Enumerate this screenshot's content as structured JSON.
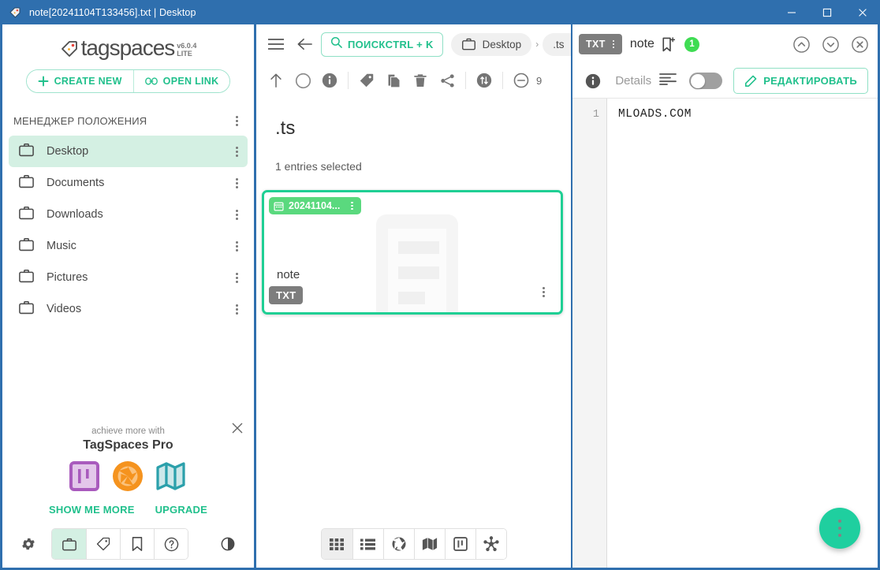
{
  "window": {
    "title": "note[20241104T133456].txt | Desktop",
    "app_icon": "tag-icon",
    "minimize_label": "–",
    "maximize_label": "□",
    "close_label": "×",
    "titlebar_color": "#2f6fae"
  },
  "theme": {
    "accent": "#21c08c",
    "accent_fab": "#1fcf9f",
    "selection_border": "#1fcf94",
    "tag_green": "#5ad97e",
    "badge_green": "#3fdc53",
    "sidebar_active": "#d4f0e3",
    "ext_badge_gray": "#7d7d7d"
  },
  "sidebar": {
    "logo": {
      "text": "tagspaces",
      "version": "v6.0.4",
      "edition": "LITE",
      "icon": "tagspaces-logo-icon"
    },
    "create_new_label": "CREATE NEW",
    "create_new_icon": "plus-icon",
    "open_link_label": "OPEN LINK",
    "open_link_icon": "link-icon",
    "section_title": "МЕНЕДЖЕР ПОЛОЖЕНИЯ",
    "locations": [
      {
        "label": "Desktop",
        "icon": "briefcase-icon",
        "active": true
      },
      {
        "label": "Documents",
        "icon": "briefcase-icon",
        "active": false
      },
      {
        "label": "Downloads",
        "icon": "briefcase-icon",
        "active": false
      },
      {
        "label": "Music",
        "icon": "briefcase-icon",
        "active": false
      },
      {
        "label": "Pictures",
        "icon": "briefcase-icon",
        "active": false
      },
      {
        "label": "Videos",
        "icon": "briefcase-icon",
        "active": false
      }
    ],
    "promo": {
      "subtitle": "achieve more with",
      "title": "TagSpaces Pro",
      "close_icon": "close-icon",
      "feature_icons": [
        "kanban-icon",
        "aperture-icon",
        "map-icon"
      ],
      "show_more_label": "SHOW ME MORE",
      "upgrade_label": "UPGRADE"
    },
    "bottom_bar": {
      "settings_icon": "gear-icon",
      "tabs": [
        {
          "icon": "briefcase-icon",
          "active": true
        },
        {
          "icon": "tag-icon",
          "active": false
        },
        {
          "icon": "bookmark-icon",
          "active": false
        },
        {
          "icon": "help-circle-icon",
          "active": false
        }
      ],
      "theme_icon": "contrast-icon"
    }
  },
  "middle": {
    "menu_icon": "hamburger-icon",
    "back_icon": "arrow-left-icon",
    "search": {
      "icon": "search-icon",
      "label": "ПОИСКCTRL + K"
    },
    "breadcrumbs": [
      {
        "label": "Desktop",
        "icon": "briefcase-icon"
      },
      {
        "label": ".ts",
        "icon": ""
      }
    ],
    "breadcrumb_separator": "›",
    "toolbar_icons": [
      "arrow-up-icon",
      "circle-select-icon",
      "info-icon",
      "tag-icon",
      "copy-icon",
      "delete-icon",
      "share-icon",
      "sort-icon",
      "zoom-out-icon"
    ],
    "zoom_label": "9",
    "title": ".ts",
    "selection_status": "1 entries selected",
    "file_card": {
      "tag_label": "20241104...",
      "tag_icon": "calendar-icon",
      "name": "note",
      "extension": "TXT",
      "kebab_icon": "more-vertical-icon",
      "thumb_icon": "document-thumb-icon"
    },
    "view_modes": [
      {
        "icon": "grid-view-icon",
        "active": true
      },
      {
        "icon": "list-view-icon",
        "active": false
      },
      {
        "icon": "aperture-view-icon",
        "active": false
      },
      {
        "icon": "map-view-icon",
        "active": false
      },
      {
        "icon": "kanban-view-icon",
        "active": false
      },
      {
        "icon": "graph-view-icon",
        "active": false
      }
    ]
  },
  "right": {
    "extension_badge": "TXT",
    "filename": "note",
    "bookmark_icon": "bookmark-add-icon",
    "tag_count": "1",
    "nav_icons": [
      "chevron-up-circle-icon",
      "chevron-down-circle-icon",
      "close-circle-icon"
    ],
    "details_icon": "info-icon",
    "details_label": "Details",
    "align_icon": "text-align-icon",
    "toggle_state": "off",
    "edit_label": "РЕДАКТИРОВАТЬ",
    "edit_icon": "pencil-icon",
    "editor": {
      "lines": [
        {
          "number": "1",
          "text": "MLOADS.COM"
        }
      ]
    },
    "fab_icon": "more-vertical-icon"
  }
}
